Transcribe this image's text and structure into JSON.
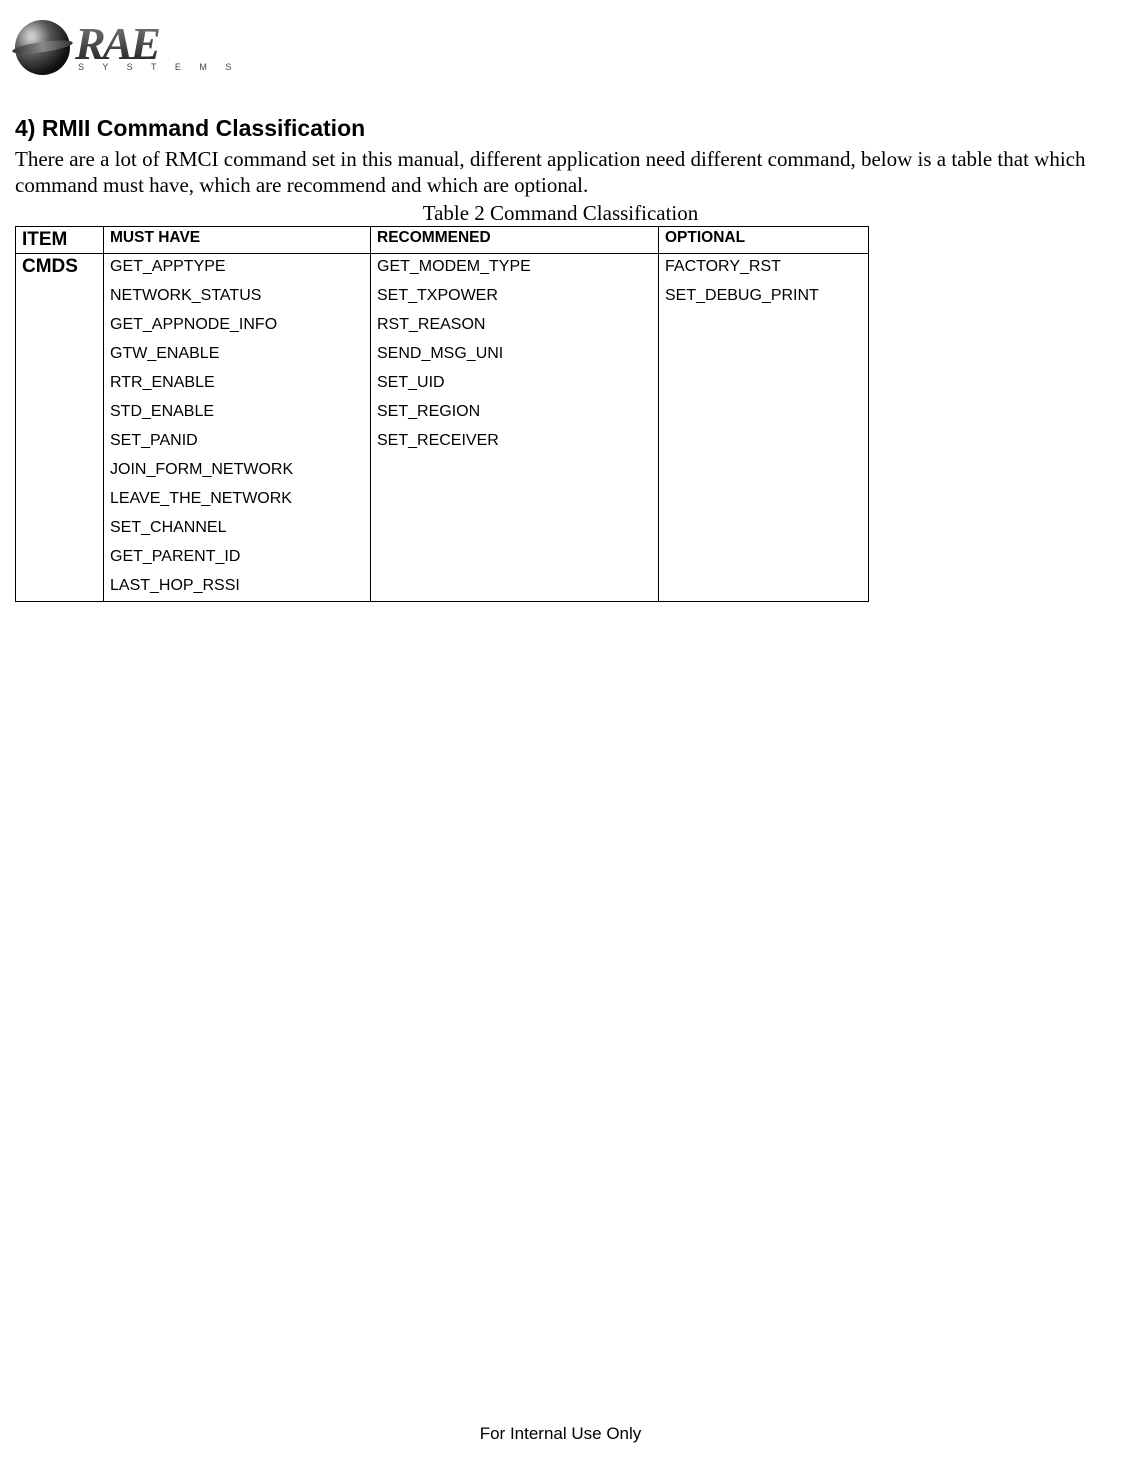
{
  "logo": {
    "name": "RAE",
    "subtitle": "S Y S T E M S"
  },
  "heading": "4) RMII Command Classification",
  "intro": "There are a lot of RMCI command set in this manual, different application need different command, below is a table that which command must have, which are recommend and which are optional.",
  "table_caption": "Table 2 Command Classification",
  "table": {
    "headers": {
      "item": "ITEM",
      "must_have": "MUST HAVE",
      "recommended": "RECOMMENED",
      "optional": "OPTIONAL"
    },
    "row_label": "CMDS",
    "must_have": [
      "GET_APPTYPE",
      "NETWORK_STATUS",
      "GET_APPNODE_INFO",
      "GTW_ENABLE",
      "RTR_ENABLE",
      "STD_ENABLE",
      "SET_PANID",
      "JOIN_FORM_NETWORK",
      "LEAVE_THE_NETWORK",
      "SET_CHANNEL",
      "GET_PARENT_ID",
      "LAST_HOP_RSSI"
    ],
    "recommended": [
      "GET_MODEM_TYPE",
      "SET_TXPOWER",
      "RST_REASON",
      "SEND_MSG_UNI",
      "SET_UID",
      "SET_REGION",
      "SET_RECEIVER"
    ],
    "optional": [
      "FACTORY_RST",
      "SET_DEBUG_PRINT"
    ]
  },
  "footer": "For Internal Use Only"
}
